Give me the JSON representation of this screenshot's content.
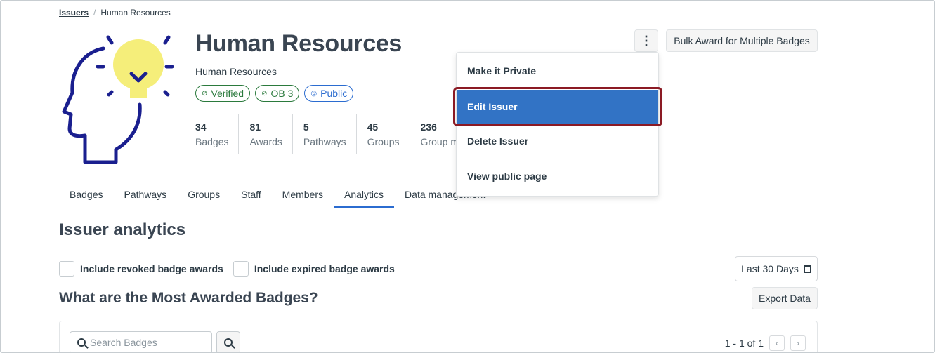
{
  "breadcrumb": {
    "root": "Issuers",
    "separator": "/",
    "current": "Human Resources"
  },
  "issuer": {
    "title": "Human Resources",
    "subtitle": "Human Resources",
    "tags": [
      {
        "label": "Verified",
        "icon": "check-circle-icon",
        "color": "#2b7a3d"
      },
      {
        "label": "OB 3",
        "icon": "ob-icon",
        "color": "#2b7a3d"
      },
      {
        "label": "Public",
        "icon": "eye-icon",
        "color": "#2b6cd0"
      }
    ],
    "stats": [
      {
        "value": "34",
        "label": "Badges"
      },
      {
        "value": "81",
        "label": "Awards"
      },
      {
        "value": "5",
        "label": "Pathways"
      },
      {
        "value": "45",
        "label": "Groups"
      },
      {
        "value": "236",
        "label": "Group m"
      }
    ]
  },
  "toolbar": {
    "more_icon": "vertical-ellipsis-icon",
    "bulk_award_label": "Bulk Award for Multiple Badges"
  },
  "menu": {
    "items": [
      "Make it Private",
      "Edit Issuer",
      "Delete Issuer",
      "View public page"
    ],
    "highlighted": "Edit Issuer",
    "highlight_color": "#3273c5",
    "callout_color": "#8b1a24"
  },
  "tabs": [
    "Badges",
    "Pathways",
    "Groups",
    "Staff",
    "Members",
    "Analytics",
    "Data management"
  ],
  "active_tab": "Analytics",
  "analytics": {
    "title": "Issuer analytics",
    "include_revoked": "Include revoked badge awards",
    "include_expired": "Include expired badge awards",
    "date_range": "Last 30 Days",
    "question": "What are the Most Awarded Badges?",
    "export_label": "Export Data",
    "search_placeholder": "Search Badges",
    "pagination": "1 - 1 of 1"
  },
  "colors": {
    "accent": "#2b6cd0",
    "logo_blue": "#1a1f8f",
    "logo_bulb": "#f5ee7a"
  }
}
